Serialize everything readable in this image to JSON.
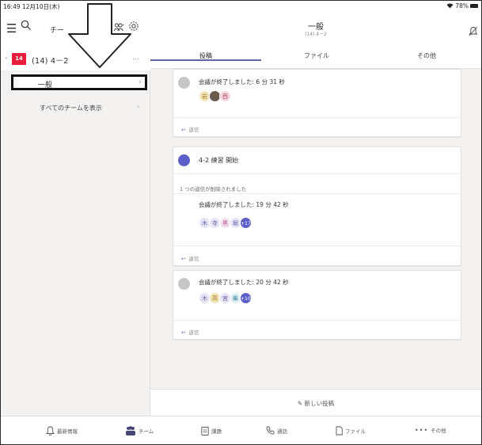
{
  "status": {
    "time": "16:49  12月10日(木)",
    "battery": "78%",
    "wifi_icon": "wifi-icon"
  },
  "left": {
    "title": "チー",
    "team": {
      "badge": "14",
      "name": "(14) 4－2",
      "more": "…"
    },
    "channel": {
      "label": "一般",
      "arrow": "›"
    },
    "all_teams": {
      "label": "すべてのチームを表示",
      "arrow": "›"
    }
  },
  "header": {
    "title": "一般",
    "subtitle": "(14) 4－2"
  },
  "tabs": [
    {
      "label": "投稿"
    },
    {
      "label": "ファイル"
    },
    {
      "label": "その他"
    }
  ],
  "cards": [
    {
      "meeting_text": "会議が終了しました: 6 分 31 秒",
      "avatars": [
        "岩",
        "",
        "西"
      ],
      "reply": "返信"
    },
    {
      "title": "4-2 練習 開始",
      "notice": "1 つの返信が削除されました",
      "meeting_text": "会議が終了しました: 19 分 42 秒",
      "avatars": [
        "木",
        "寺",
        "黒",
        "堀"
      ],
      "more": "+17",
      "reply": "返信"
    },
    {
      "meeting_text": "会議が終了しました: 20 分 42 秒",
      "avatars": [
        "木",
        "高",
        "宮",
        "柴"
      ],
      "more": "+10",
      "reply": "返信"
    }
  ],
  "new_post": {
    "label": "新しい投稿"
  },
  "bottom_nav": [
    {
      "label": "最新情報",
      "icon": "bell-icon"
    },
    {
      "label": "チーム",
      "icon": "teams-icon"
    },
    {
      "label": "課題",
      "icon": "assignments-icon"
    },
    {
      "label": "通話",
      "icon": "phone-icon"
    },
    {
      "label": "ファイル",
      "icon": "file-icon"
    },
    {
      "label": "その他",
      "icon": "more-icon"
    }
  ],
  "colors": {
    "accent": "#6264a7",
    "team_badge": "#e81e3c",
    "avatar_more": "#5b5fc7",
    "pane_bg": "#f3f2f1"
  }
}
